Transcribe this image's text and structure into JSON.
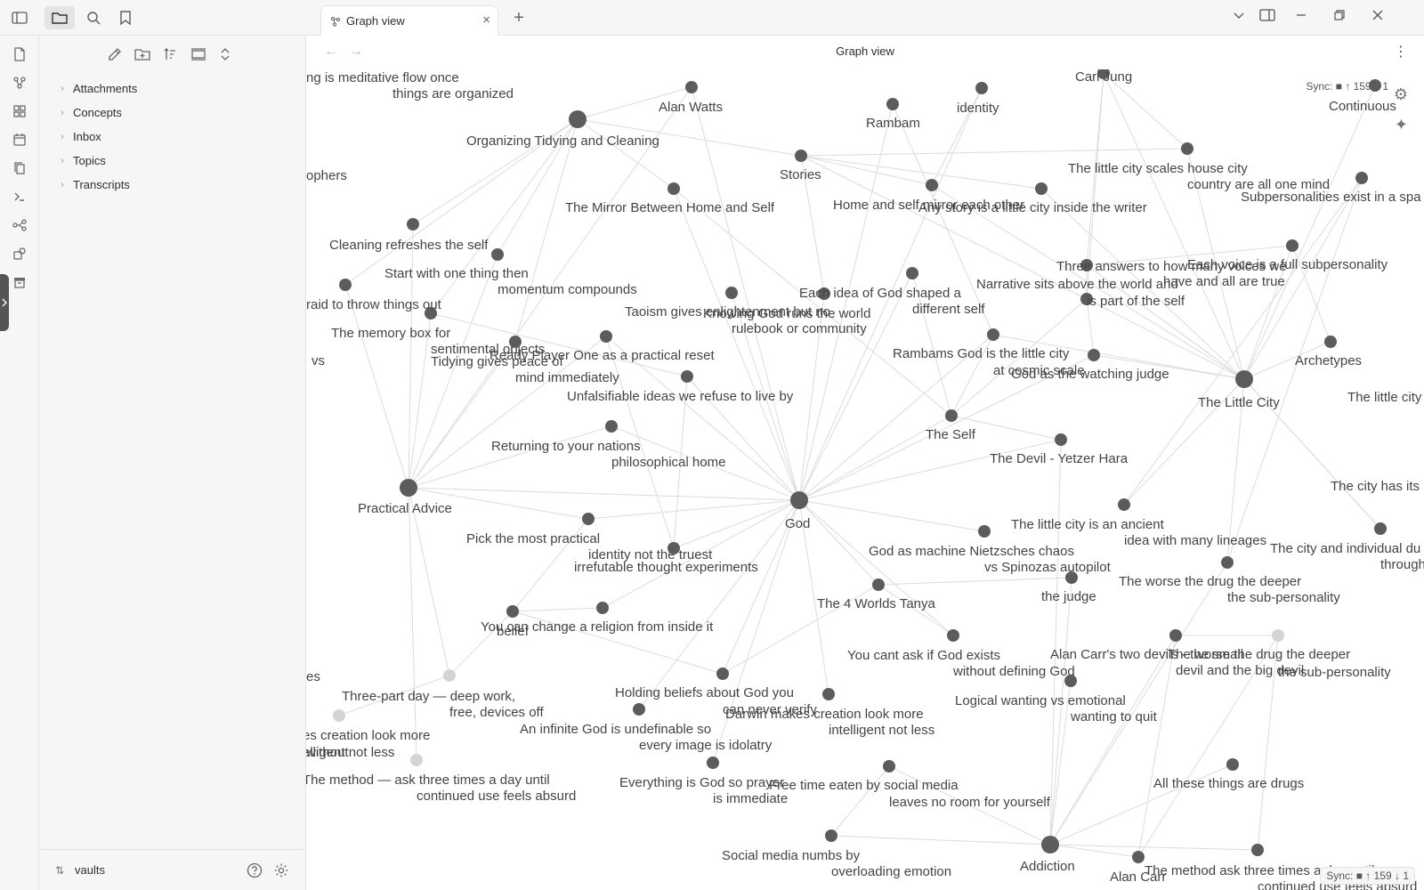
{
  "sidebar_nav": {
    "icons": [
      "files-icon",
      "search-icon",
      "bookmark-icon"
    ]
  },
  "sidebar": {
    "tree": [
      {
        "label": "Attachments"
      },
      {
        "label": "Concepts"
      },
      {
        "label": "Inbox"
      },
      {
        "label": "Topics"
      },
      {
        "label": "Transcripts"
      }
    ],
    "vault_name": "vaults"
  },
  "tab": {
    "label": "Graph view"
  },
  "view": {
    "title": "Graph view"
  },
  "sync_status": "Sync: ■ ↑ 159 ↓ 1",
  "graph": {
    "nodes": [
      {
        "id": "n1",
        "label": "Organizing Tidying and Cleaning",
        "size": "large"
      },
      {
        "id": "n2",
        "label": "Alan Watts",
        "size": "small"
      },
      {
        "id": "n3",
        "label": "Rambam",
        "size": "small"
      },
      {
        "id": "n4",
        "label": "identity",
        "size": "small"
      },
      {
        "id": "n5",
        "label": "Carl Jung",
        "size": "small"
      },
      {
        "id": "n6",
        "label": "Stories",
        "size": "small"
      },
      {
        "id": "n7",
        "label": "Continuous",
        "size": "small"
      },
      {
        "id": "n8",
        "label": "The little city scales house city country are all one mind",
        "size": "small"
      },
      {
        "id": "n9",
        "label": "The Mirror Between Home and Self",
        "size": "small"
      },
      {
        "id": "n10",
        "label": "Home and self mirror each other",
        "size": "small"
      },
      {
        "id": "n11",
        "label": "Any story is a little city inside the writer",
        "size": "small"
      },
      {
        "id": "n12",
        "label": "Subpersonalities exist in a spa",
        "size": "small"
      },
      {
        "id": "n13",
        "label": "Cleaning refreshes the self",
        "size": "small"
      },
      {
        "id": "n14",
        "label": "Start with one thing then momentum compounds",
        "size": "small"
      },
      {
        "id": "n15",
        "label": "Three answers to how many voices we have and all are true",
        "size": "small"
      },
      {
        "id": "n16",
        "label": "Each voice is a full subpersonality",
        "size": "small"
      },
      {
        "id": "n17",
        "label": "Narrative sits above the world and is part of the self",
        "size": "small"
      },
      {
        "id": "n18",
        "label": "Taoism gives enlightenment but no rulebook or community",
        "size": "small"
      },
      {
        "id": "n19",
        "label": "Knowing God runs the world",
        "size": "small"
      },
      {
        "id": "n20",
        "label": "Each idea of God shaped a different self",
        "size": "small"
      },
      {
        "id": "n21",
        "label": "The memory box for sentimental objects",
        "size": "small"
      },
      {
        "id": "n22",
        "label": "Tidying gives peace of mind immediately",
        "size": "small"
      },
      {
        "id": "n23",
        "label": "Ready Player One as a practical reset",
        "size": "small"
      },
      {
        "id": "n24",
        "label": "Rambams God is the little city at cosmic scale",
        "size": "small"
      },
      {
        "id": "n25",
        "label": "God as the watching judge",
        "size": "small"
      },
      {
        "id": "n26",
        "label": "Archetypes",
        "size": "small"
      },
      {
        "id": "n27",
        "label": "The Little City",
        "size": "large"
      },
      {
        "id": "n28",
        "label": "Unfalsifiable ideas we refuse to live by",
        "size": "small"
      },
      {
        "id": "n29",
        "label": "The Self",
        "size": "small"
      },
      {
        "id": "n30",
        "label": "The Devil - Yetzer Hara",
        "size": "small"
      },
      {
        "id": "n31",
        "label": "Returning to your nations philosophical home",
        "size": "small"
      },
      {
        "id": "n32",
        "label": "Practical Advice",
        "size": "large"
      },
      {
        "id": "n33",
        "label": "God",
        "size": "large"
      },
      {
        "id": "n34",
        "label": "The little city is an ancient idea with many lineages",
        "size": "small"
      },
      {
        "id": "n35",
        "label": "The city and individual du through Western philo",
        "size": "small"
      },
      {
        "id": "n36",
        "label": "Pick the most practical identity not the truest",
        "size": "small"
      },
      {
        "id": "n37",
        "label": "irrefutable thought experiments",
        "size": "small"
      },
      {
        "id": "n38",
        "label": "God as machine Nietzsches chaos vs Spinozas autopilot",
        "size": "small"
      },
      {
        "id": "n39",
        "label": "the judge",
        "size": "small"
      },
      {
        "id": "n40",
        "label": "The worse the drug the deeper the sub-personality",
        "size": "small"
      },
      {
        "id": "n41",
        "label": "The 4 Worlds Tanya",
        "size": "small"
      },
      {
        "id": "n42",
        "label": "belief",
        "size": "small"
      },
      {
        "id": "n43",
        "label": "You can change a religion from inside it",
        "size": "small"
      },
      {
        "id": "n44",
        "label": "You cant ask if God exists without defining God",
        "size": "small"
      },
      {
        "id": "n45",
        "label": "Alan Carr's two devils - the small devil and the big devil",
        "size": "small"
      },
      {
        "id": "n46",
        "label": "The worse the drug the deeper the sub-personality",
        "size": "faded"
      },
      {
        "id": "n47",
        "label": "Three-part day — deep work, free, devices off",
        "size": "faded"
      },
      {
        "id": "n48",
        "label": "Holding beliefs about God you can never verify",
        "size": "small"
      },
      {
        "id": "n49",
        "label": "Logical wanting vs emotional wanting to quit",
        "size": "small"
      },
      {
        "id": "n50",
        "label": "Darwin makes creation look more intelligent not less",
        "size": "small"
      },
      {
        "id": "n51",
        "label": "An infinite God is undefinable so every image is idolatry",
        "size": "small"
      },
      {
        "id": "n52",
        "label": "Everything is God so prayer is immediate",
        "size": "small"
      },
      {
        "id": "n53",
        "label": "Free time eaten by social media leaves no room for yourself",
        "size": "small"
      },
      {
        "id": "n54",
        "label": "All these things are drugs",
        "size": "small"
      },
      {
        "id": "n55",
        "label": "Social media numbs by overloading emotion",
        "size": "small"
      },
      {
        "id": "n56",
        "label": "Addiction",
        "size": "large"
      },
      {
        "id": "n57",
        "label": "Alan Carr",
        "size": "small"
      },
      {
        "id": "n58",
        "label": "The method ask three times a day until continued use feels absurd",
        "size": "small"
      },
      {
        "id": "n59",
        "label": "The method — ask three times a day until continued use feels absurd",
        "size": "faded"
      },
      {
        "id": "n60",
        "label": "es creation look more elligent not less",
        "size": "faded"
      },
      {
        "id": "n61",
        "label": "ng is meditative flow once things are organized",
        "size": "none"
      },
      {
        "id": "n62",
        "label": "ophers",
        "size": "none"
      },
      {
        "id": "n63",
        "label": "raid to throw things out",
        "size": "small"
      },
      {
        "id": "n64",
        "label": "vs",
        "size": "none"
      },
      {
        "id": "n65",
        "label": "The little city",
        "size": "none"
      },
      {
        "id": "n66",
        "label": "The city has its",
        "size": "none"
      },
      {
        "id": "n67",
        "label": "es",
        "size": "none"
      },
      {
        "id": "n68",
        "label": "without",
        "size": "none"
      }
    ]
  }
}
